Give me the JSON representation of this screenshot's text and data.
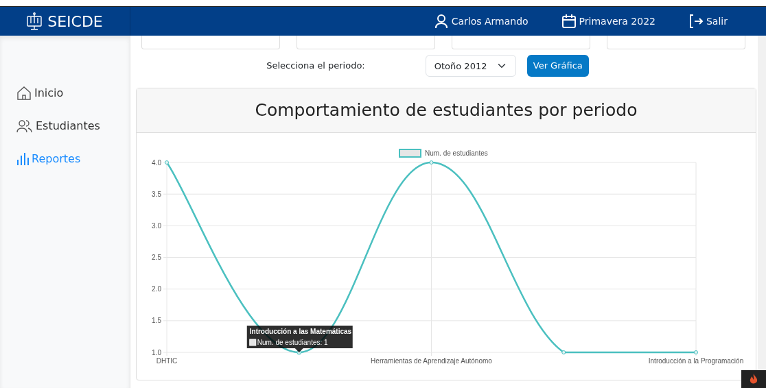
{
  "navbar": {
    "brand": "SEICDE",
    "items": [
      {
        "kind": "user",
        "label": "Carlos Armando"
      },
      {
        "kind": "calendar",
        "label": "Primavera 2022"
      },
      {
        "kind": "logout",
        "label": "Salir"
      }
    ]
  },
  "sidebar": {
    "items": [
      {
        "kind": "home",
        "label": "Inicio",
        "selected": false
      },
      {
        "kind": "people",
        "label": "Estudiantes",
        "selected": false
      },
      {
        "kind": "chart",
        "label": "Reportes",
        "selected": true
      }
    ]
  },
  "filter": {
    "label": "Selecciona el periodo:",
    "select_value": "Otoño 2012",
    "button": "Ver Gráfica"
  },
  "card": {
    "title": "Comportamiento de estudiantes por periodo",
    "chart_data": {
      "type": "line",
      "categories": [
        "DHTIC",
        null,
        "Herramientas de Aprendizaje Autónomo",
        null,
        "Introducción a la Programación"
      ],
      "series": [
        {
          "name": "Num. de estudiantes",
          "color": "#4bc0c0",
          "marker": true,
          "values": [
            4,
            1,
            4,
            1,
            1
          ]
        }
      ],
      "grid": true,
      "ylim": [
        1,
        4
      ],
      "yticks": [
        {
          "value": 1,
          "label": "1.0"
        },
        {
          "value": 1.5,
          "label": "1.5"
        },
        {
          "value": 2,
          "label": "2.0"
        },
        {
          "value": 2.5,
          "label": "2.5"
        },
        {
          "value": 3,
          "label": "3.0"
        },
        {
          "value": 3.5,
          "label": "3.5"
        },
        {
          "value": 4,
          "label": "4.0"
        }
      ],
      "legend": true
    },
    "tooltip": {
      "active_points": [
        false,
        true,
        false,
        false,
        false
      ],
      "title": "Introducción a las Matemáticas",
      "text": "Num. de estudiantes: 1"
    }
  }
}
